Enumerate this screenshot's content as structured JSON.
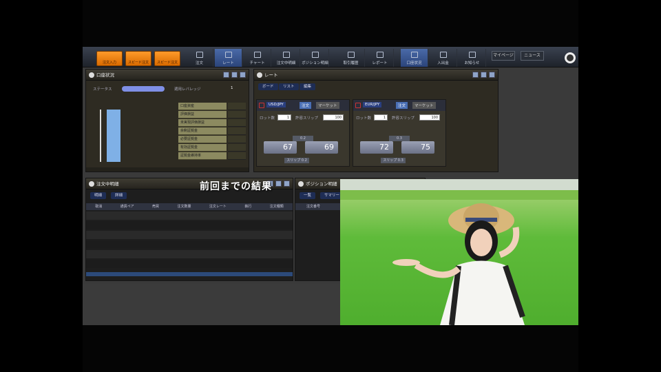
{
  "toolbar": {
    "orange_buttons": [
      "注文入力",
      "スピード注文",
      "スピード注文"
    ],
    "buttons": [
      {
        "label": "注文",
        "active": false
      },
      {
        "label": "レート",
        "active": true
      },
      {
        "label": "チャート",
        "active": false
      },
      {
        "label": "注文中明細",
        "active": false
      },
      {
        "label": "ポジション明細",
        "active": false
      },
      {
        "label": "取引履歴",
        "active": false
      },
      {
        "label": "レポート",
        "active": false
      },
      {
        "label": "口座状況",
        "active": true
      },
      {
        "label": "入出金",
        "active": false
      },
      {
        "label": "お知らせ",
        "active": false
      }
    ],
    "mypage": "マイページ",
    "news": "ニュース"
  },
  "account_panel": {
    "title": "口座状況",
    "status_label": "ステータス",
    "leverage_label": "適用レバレッジ",
    "leverage_value": "1",
    "rows": [
      "口座資産",
      "評価損益",
      "未実現評価損益",
      "余剰証拠金",
      "必要証拠金",
      "有効証拠金",
      "証拠金維持率"
    ]
  },
  "rate_panel": {
    "title": "レート",
    "tabs": [
      "ボード",
      "リスト",
      "編集"
    ],
    "pairs": [
      {
        "name": "USD/JPY",
        "order": "注文",
        "market": "マーケット",
        "lot_label": "ロット数",
        "lot": "1",
        "slip_label": "許容スリップ",
        "slip": "100",
        "bid": "67",
        "ask": "69",
        "spread": "0.2",
        "foot": "スリップ 0.2"
      },
      {
        "name": "EUR/JPY",
        "order": "注文",
        "market": "マーケット",
        "lot_label": "ロット数",
        "lot": "1",
        "slip_label": "許容スリップ",
        "slip": "100",
        "bid": "72",
        "ask": "75",
        "spread": "0.3",
        "foot": "スリップ 0.3"
      }
    ]
  },
  "orders_panel": {
    "title": "注文中明細",
    "tabs": [
      "明細",
      "詳細"
    ],
    "headers": [
      "取消",
      "通貨ペア",
      "売買",
      "注文数量",
      "注文レート",
      "執行",
      "注文種類"
    ]
  },
  "positions_panel": {
    "title": "ポジション明細",
    "tabs": [
      "一覧",
      "サマリー"
    ],
    "headers": [
      "注文番号"
    ]
  },
  "overlay_text": "前回までの結果",
  "colors": {
    "accent": "#7f8fe6",
    "orange": "#ff9a2a"
  }
}
